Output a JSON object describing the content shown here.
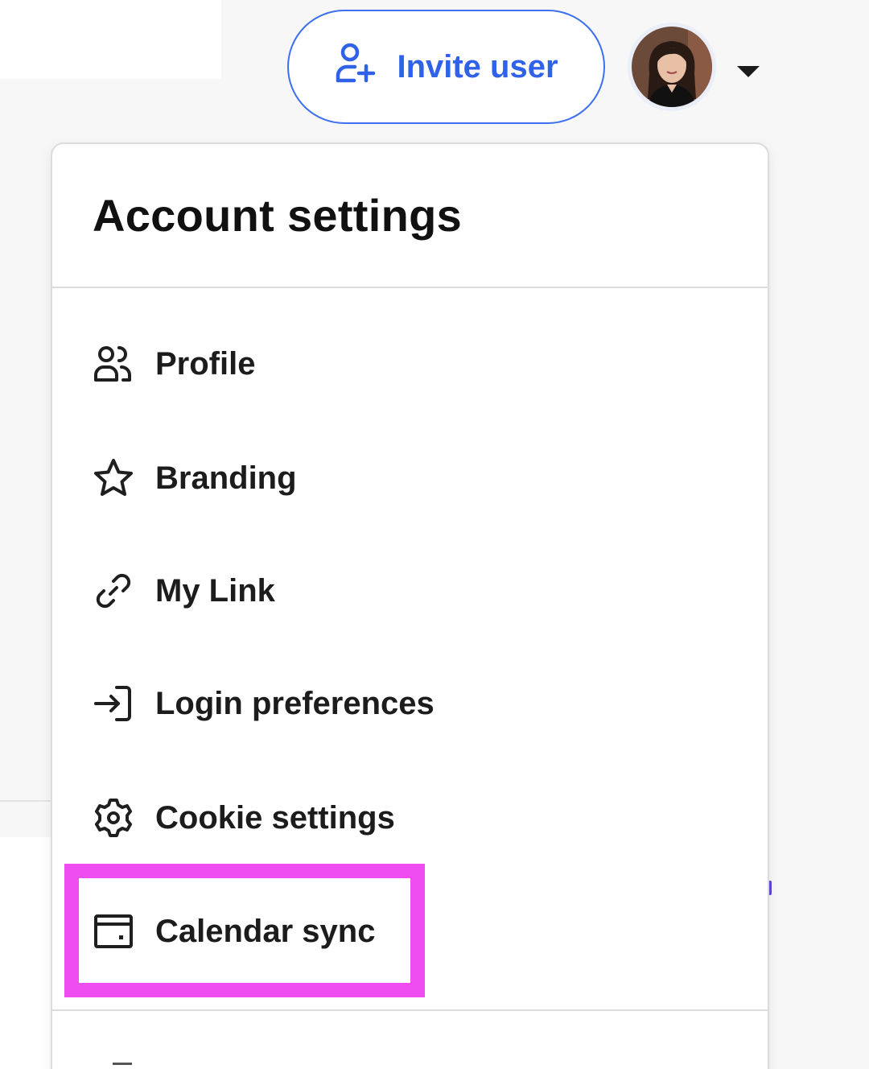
{
  "header": {
    "invite_label": "Invite user",
    "accent_color": "#2f62e8",
    "avatar_icon": "user-avatar-photo"
  },
  "menu": {
    "title": "Account settings",
    "items": [
      {
        "label": "Profile",
        "icon": "users-icon"
      },
      {
        "label": "Branding",
        "icon": "star-icon"
      },
      {
        "label": "My Link",
        "icon": "link-icon"
      },
      {
        "label": "Login preferences",
        "icon": "login-icon"
      },
      {
        "label": "Cookie settings",
        "icon": "gear-icon"
      },
      {
        "label": "Calendar sync",
        "icon": "calendar-icon",
        "highlighted": true
      }
    ],
    "highlight_color": "#ef4cf2"
  }
}
